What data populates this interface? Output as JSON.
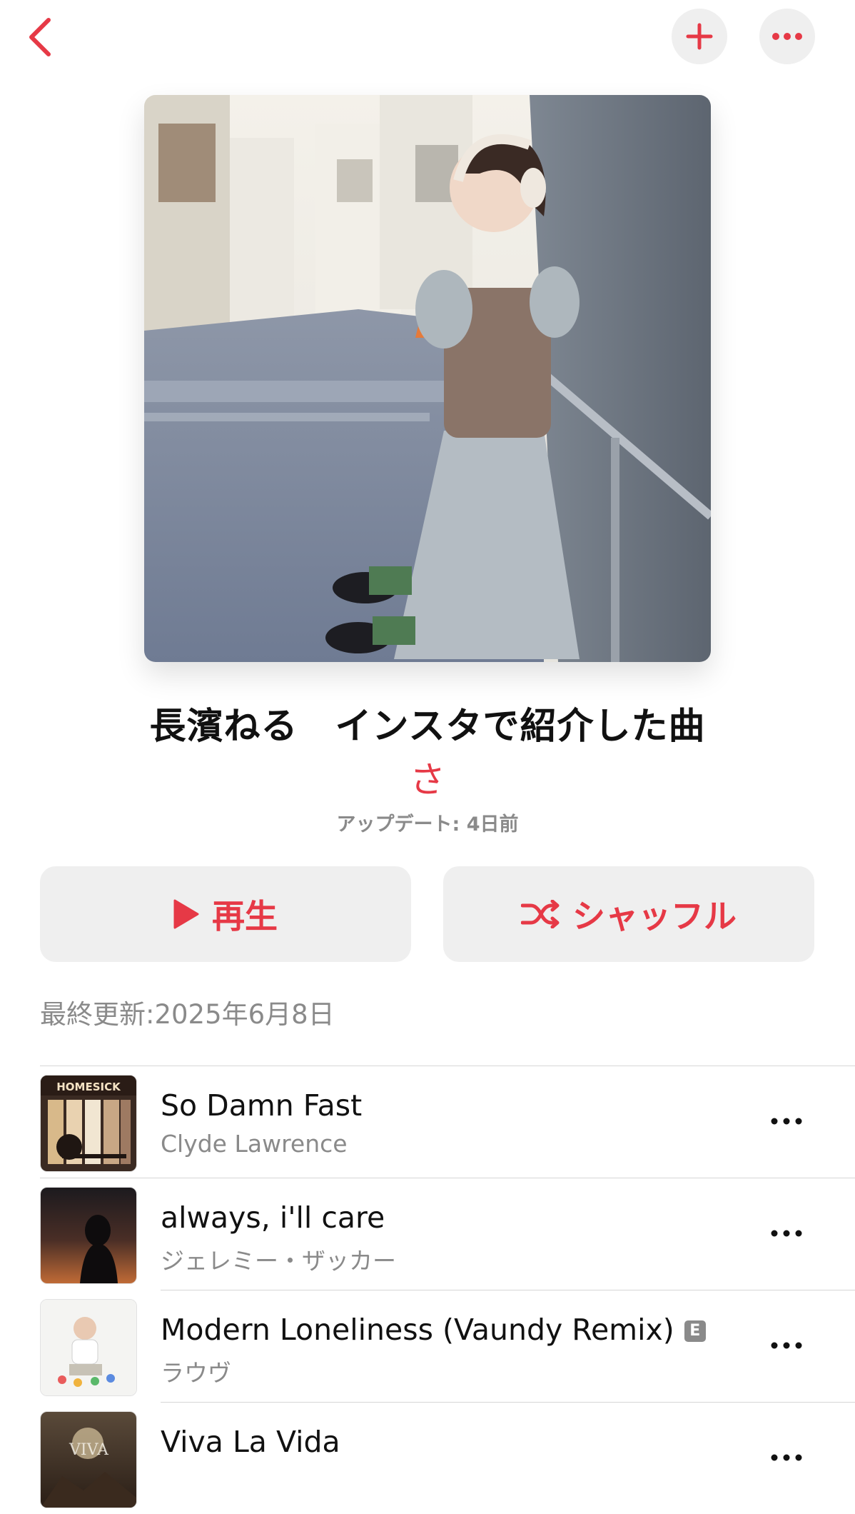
{
  "nav": {
    "back_icon": "chevron-left-icon",
    "add_icon": "plus-icon",
    "more_icon": "ellipsis-icon"
  },
  "playlist": {
    "title": "長濱ねる　インスタで紹介した曲",
    "curator": "さ",
    "updated": "アップデート: 4日前",
    "last_modified": "最終更新:2025年6月8日"
  },
  "actions": {
    "play_label": "再生",
    "shuffle_label": "シャッフル"
  },
  "tracks": [
    {
      "title": "So Damn Fast",
      "artist": "Clyde Lawrence",
      "explicit": false,
      "art_text": "HOMESICK"
    },
    {
      "title": "always, i'll care",
      "artist": "ジェレミー・ザッカー",
      "explicit": false
    },
    {
      "title": "Modern Loneliness (Vaundy Remix)",
      "artist": "ラウヴ",
      "explicit": true,
      "explicit_label": "E"
    },
    {
      "title": "Viva La Vida",
      "artist": "",
      "explicit": false
    }
  ],
  "colors": {
    "accent": "#e63946",
    "secondary_text": "#8a8a8a",
    "button_bg": "#efefef"
  }
}
